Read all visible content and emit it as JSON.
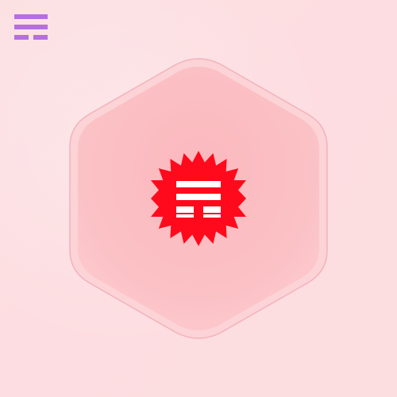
{
  "app": {
    "menu_icon": "hexagram-menu-icon",
    "badge_icon": "hexagram-icon",
    "colors": {
      "background": "#fde0e3",
      "menu_icon": "#b56fe0",
      "hexagon_fill": "#fbc3c6",
      "hexagon_border": "#f2a9b3",
      "badge": "#ff0a1c",
      "badge_glyph": "#ffffff"
    }
  }
}
